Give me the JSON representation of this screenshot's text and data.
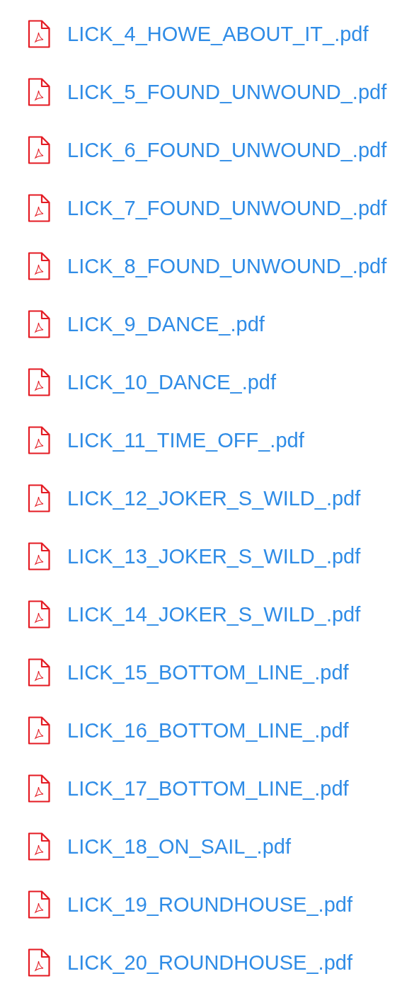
{
  "files": [
    {
      "name": "LICK_4_HOWE_ABOUT_IT_.pdf"
    },
    {
      "name": "LICK_5_FOUND_UNWOUND_.pdf"
    },
    {
      "name": "LICK_6_FOUND_UNWOUND_.pdf"
    },
    {
      "name": "LICK_7_FOUND_UNWOUND_.pdf"
    },
    {
      "name": "LICK_8_FOUND_UNWOUND_.pdf"
    },
    {
      "name": "LICK_9_DANCE_.pdf"
    },
    {
      "name": "LICK_10_DANCE_.pdf"
    },
    {
      "name": "LICK_11_TIME_OFF_.pdf"
    },
    {
      "name": "LICK_12_JOKER_S_WILD_.pdf"
    },
    {
      "name": "LICK_13_JOKER_S_WILD_.pdf"
    },
    {
      "name": "LICK_14_JOKER_S_WILD_.pdf"
    },
    {
      "name": "LICK_15_BOTTOM_LINE_.pdf"
    },
    {
      "name": "LICK_16_BOTTOM_LINE_.pdf"
    },
    {
      "name": "LICK_17_BOTTOM_LINE_.pdf"
    },
    {
      "name": "LICK_18_ON_SAIL_.pdf"
    },
    {
      "name": "LICK_19_ROUNDHOUSE_.pdf"
    },
    {
      "name": "LICK_20_ROUNDHOUSE_.pdf"
    }
  ]
}
